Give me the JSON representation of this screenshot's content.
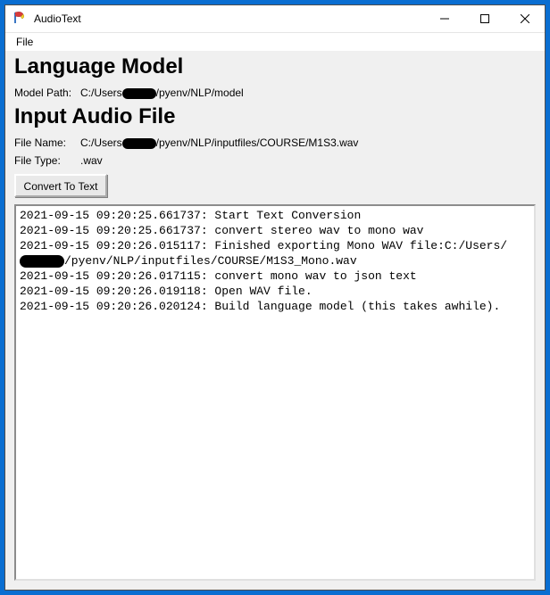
{
  "window": {
    "title": "AudioText"
  },
  "menubar": {
    "file": "File"
  },
  "sections": {
    "language_model": "Language Model",
    "input_audio": "Input Audio File"
  },
  "fields": {
    "model_path_label": "Model Path:",
    "model_path_prefix": "C:/Users",
    "model_path_suffix": "/pyenv/NLP/model",
    "file_name_label": "File Name:",
    "file_name_prefix": "C:/Users",
    "file_name_suffix": "/pyenv/NLP/inputfiles/COURSE/M1S3.wav",
    "file_type_label": "File Type:",
    "file_type_value": ".wav"
  },
  "buttons": {
    "convert": "Convert To Text"
  },
  "log": {
    "l1": "2021-09-15 09:20:25.661737: Start Text Conversion",
    "l2": "2021-09-15 09:20:25.661737: convert stereo wav to mono wav",
    "l3a": "2021-09-15 09:20:26.015117: Finished exporting Mono WAV file:C:/Users/",
    "l3b": "/pyenv/NLP/inputfiles/COURSE/M1S3_Mono.wav",
    "l4": "2021-09-15 09:20:26.017115: convert mono wav to json text",
    "l5": "2021-09-15 09:20:26.019118: Open WAV file.",
    "l6": "2021-09-15 09:20:26.020124: Build language model (this takes awhile)."
  }
}
